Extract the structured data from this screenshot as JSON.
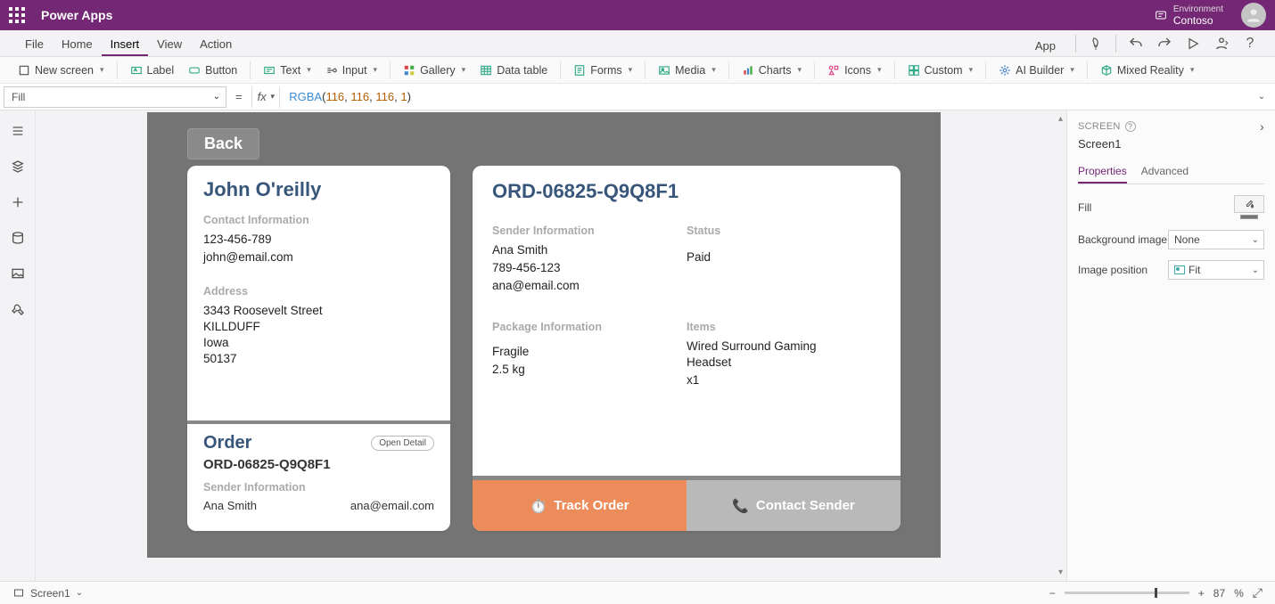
{
  "titlebar": {
    "app": "Power Apps",
    "env_label": "Environment",
    "env_value": "Contoso"
  },
  "menu": {
    "file": "File",
    "home": "Home",
    "insert": "Insert",
    "view": "View",
    "action": "Action",
    "app": "App"
  },
  "ribbon": {
    "newscreen": "New screen",
    "label": "Label",
    "button": "Button",
    "text": "Text",
    "input": "Input",
    "gallery": "Gallery",
    "datatable": "Data table",
    "forms": "Forms",
    "media": "Media",
    "charts": "Charts",
    "icons": "Icons",
    "custom": "Custom",
    "aibuilder": "AI Builder",
    "mixedreality": "Mixed Reality"
  },
  "formula": {
    "property": "Fill",
    "fx": "fx",
    "fn": "RGBA",
    "a": "116",
    "b": "116",
    "c": "116",
    "d": "1"
  },
  "rightpanel": {
    "header": "SCREEN",
    "name": "Screen1",
    "tab_props": "Properties",
    "tab_adv": "Advanced",
    "p_fill": "Fill",
    "p_bg": "Background image",
    "p_bg_val": "None",
    "p_imgpos": "Image position",
    "p_imgpos_val": "Fit"
  },
  "status": {
    "screen": "Screen1",
    "zoom": "87",
    "pct": "%"
  },
  "app": {
    "back": "Back",
    "customer": {
      "name": "John O'reilly",
      "contact_h": "Contact Information",
      "phone": "123-456-789",
      "email": "john@email.com",
      "address_h": "Address",
      "street": "3343  Roosevelt Street",
      "city": "KILLDUFF",
      "state": "Iowa",
      "zip": "50137"
    },
    "order_mini": {
      "title": "Order",
      "open": "Open Detail",
      "num": "ORD-06825-Q9Q8F1",
      "sender_h": "Sender Information",
      "sender_name": "Ana Smith",
      "sender_email": "ana@email.com"
    },
    "order": {
      "num": "ORD-06825-Q9Q8F1",
      "sender_h": "Sender Information",
      "sender_name": "Ana Smith",
      "sender_phone": "789-456-123",
      "sender_email": "ana@email.com",
      "status_h": "Status",
      "status": "Paid",
      "pack_h": "Package Information",
      "pack_l1": "Fragile",
      "pack_l2": "2.5 kg",
      "items_h": "Items",
      "item_name": "Wired Surround Gaming Headset",
      "item_qty": "x1",
      "btn_track": "Track Order",
      "btn_contact": "Contact Sender"
    }
  }
}
